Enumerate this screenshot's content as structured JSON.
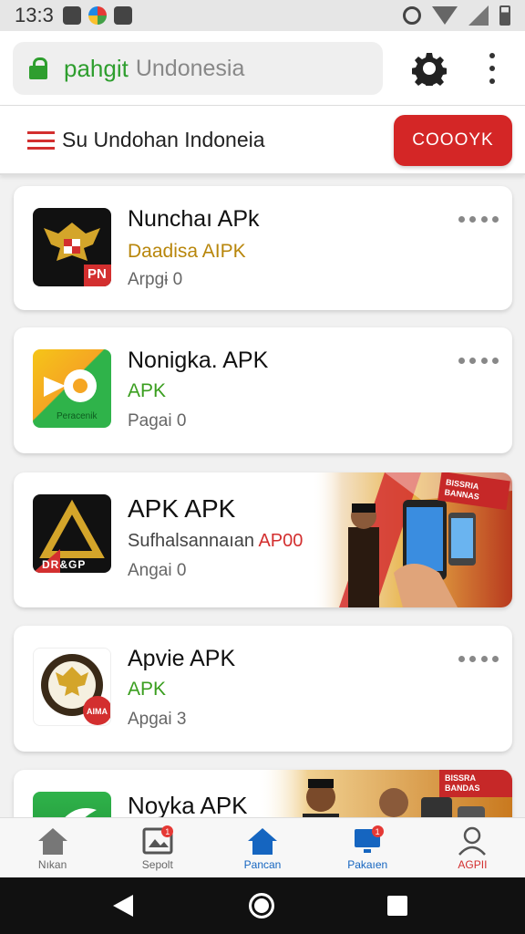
{
  "status_bar": {
    "time": "13:3"
  },
  "browser": {
    "domain": "pahgit",
    "path": "Undonesia"
  },
  "header": {
    "title": "Su Undohan Indoneia",
    "button_label": "COOOYK"
  },
  "apps": [
    {
      "name": "Nunchaı APk",
      "subtitle": "Daadisa AIPK",
      "meta": "Arpgɨ 0",
      "logo_text": "PN",
      "accent": "#b8860b"
    },
    {
      "name": "Nonigka. APK",
      "subtitle": "APK",
      "meta": "Pagai 0",
      "logo_text": "Peracenik",
      "accent": "#3a9e1f"
    },
    {
      "name": "APK APK",
      "subtitle": "Sufhalsannaıan",
      "subtitle_tag": "AP00",
      "meta": "Angai 0",
      "logo_text": "DR&GP",
      "banner_text": "BISSRIA BANNAS",
      "accent": "#d32f2f"
    },
    {
      "name": "Apvie APK",
      "subtitle": "APK",
      "meta": "Apgai 3",
      "logo_text": "AIMA",
      "accent": "#3a9e1f"
    },
    {
      "name": "Noyka APK",
      "banner_text": "BISSRA BANDAS"
    }
  ],
  "bottom_nav": [
    {
      "label": "Nıkan",
      "icon": "home-icon",
      "color": "#777"
    },
    {
      "label": "Sepolt",
      "icon": "photo-icon",
      "badge": "1",
      "color": "#777"
    },
    {
      "label": "Pancan",
      "icon": "home-icon",
      "color": "#1565c0"
    },
    {
      "label": "Pakaıen",
      "icon": "monitor-icon",
      "badge": "1",
      "color": "#1565c0"
    },
    {
      "label": "AGPII",
      "icon": "profile-icon",
      "color": "#d32f2f"
    }
  ],
  "colors": {
    "brand_red": "#d42626",
    "url_green": "#2e9e2e",
    "active_blue": "#1565c0"
  }
}
